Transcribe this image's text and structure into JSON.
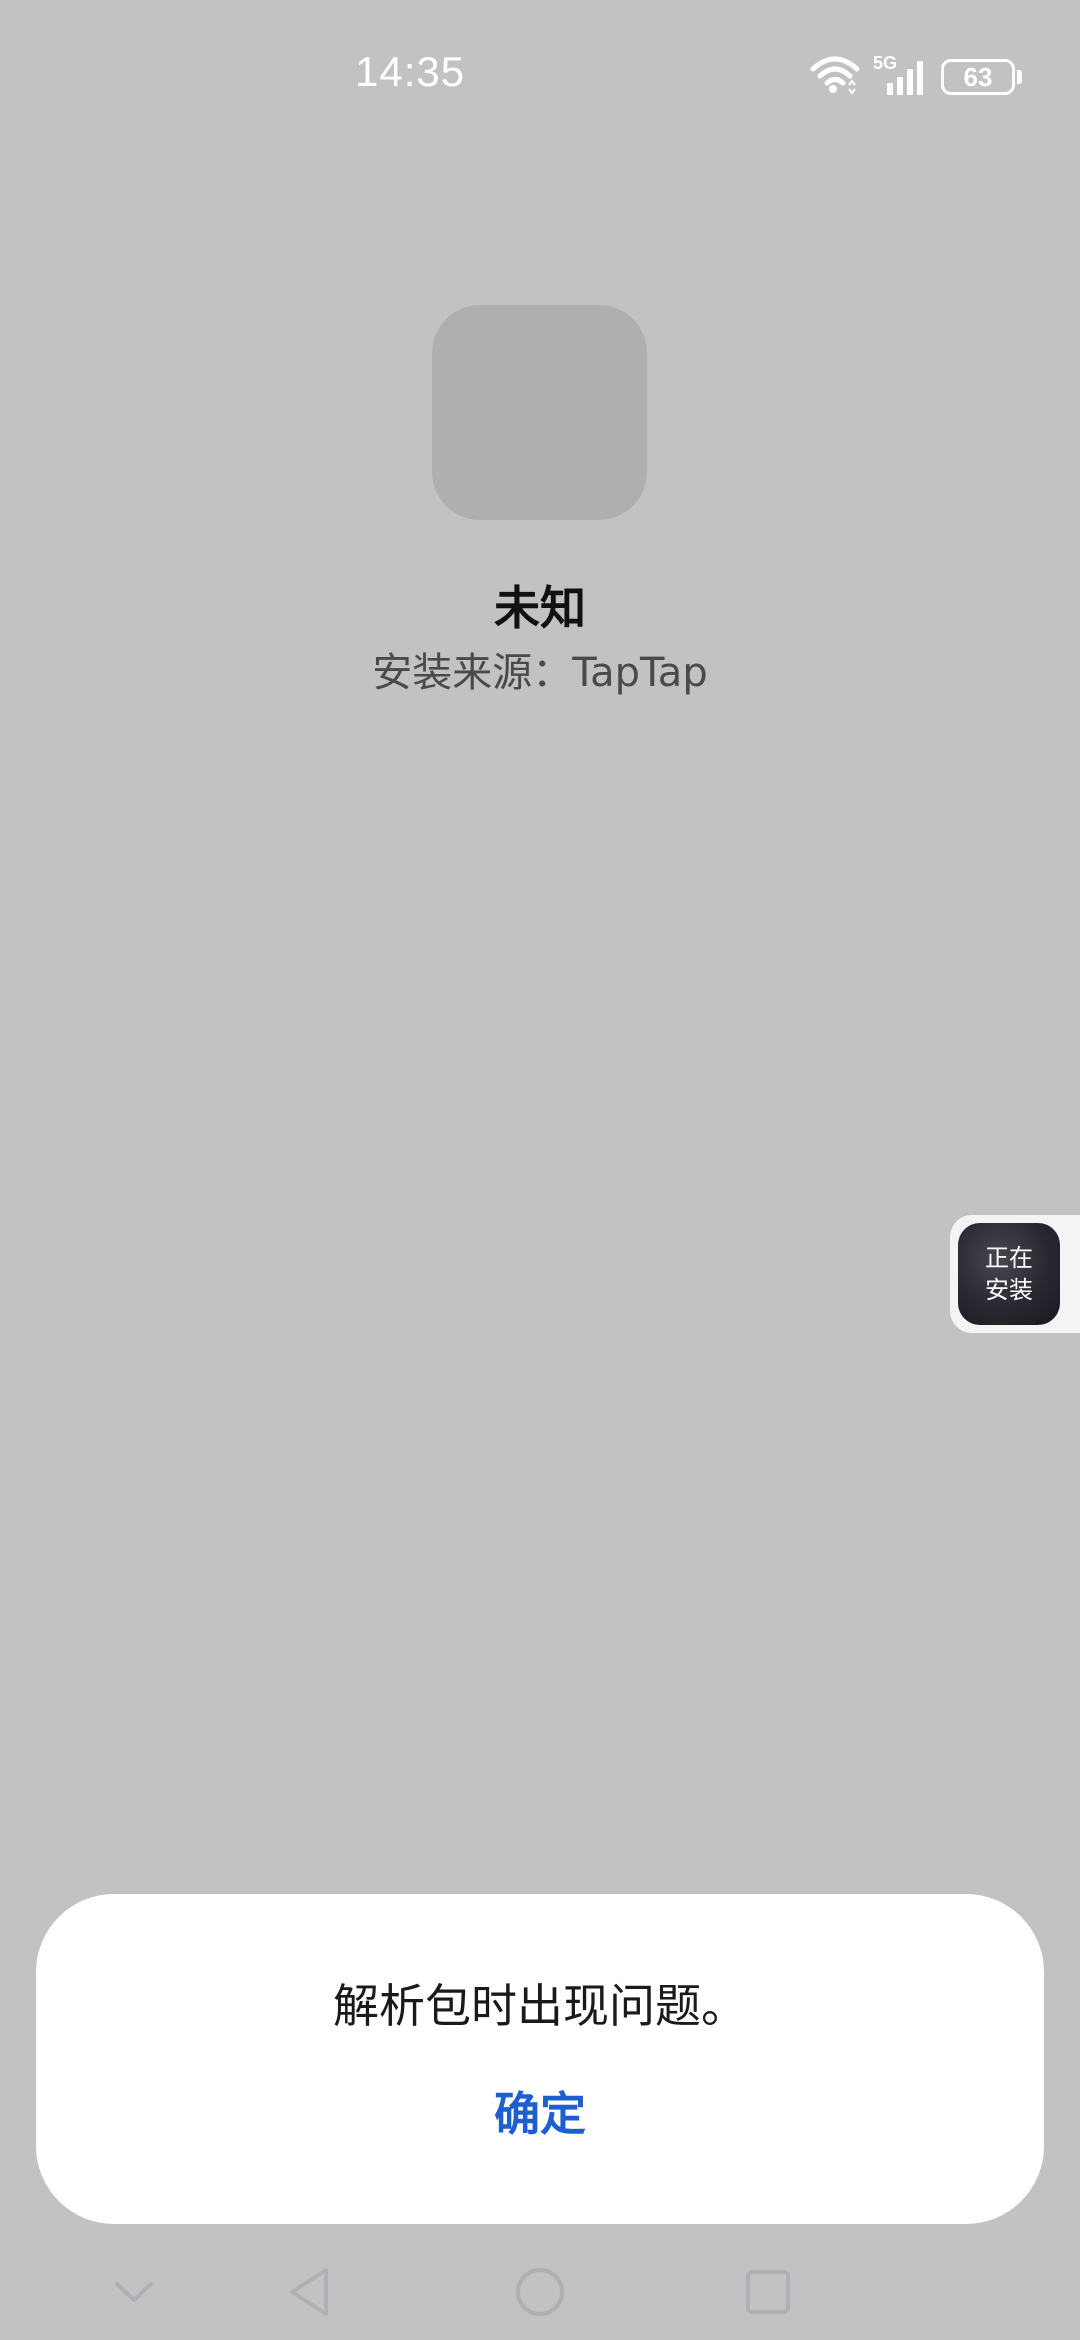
{
  "status_bar": {
    "time": "14:35",
    "network": "5G",
    "battery": "63",
    "icons": [
      "wifi-icon",
      "signal-5g-icon",
      "battery-icon"
    ]
  },
  "app": {
    "name": "未知",
    "install_source": "安装来源：TapTap"
  },
  "floating_installer": {
    "line1": "正在",
    "line2": "安装"
  },
  "dialog": {
    "message": "解析包时出现问题。",
    "confirm_label": "确定"
  },
  "nav_bar": {
    "icons": [
      "collapse-icon",
      "back-icon",
      "home-icon",
      "recents-icon"
    ]
  },
  "colors": {
    "background": "#c1c2c4",
    "accent": "#1e5fd0",
    "dialog_bg": "#ffffff"
  }
}
